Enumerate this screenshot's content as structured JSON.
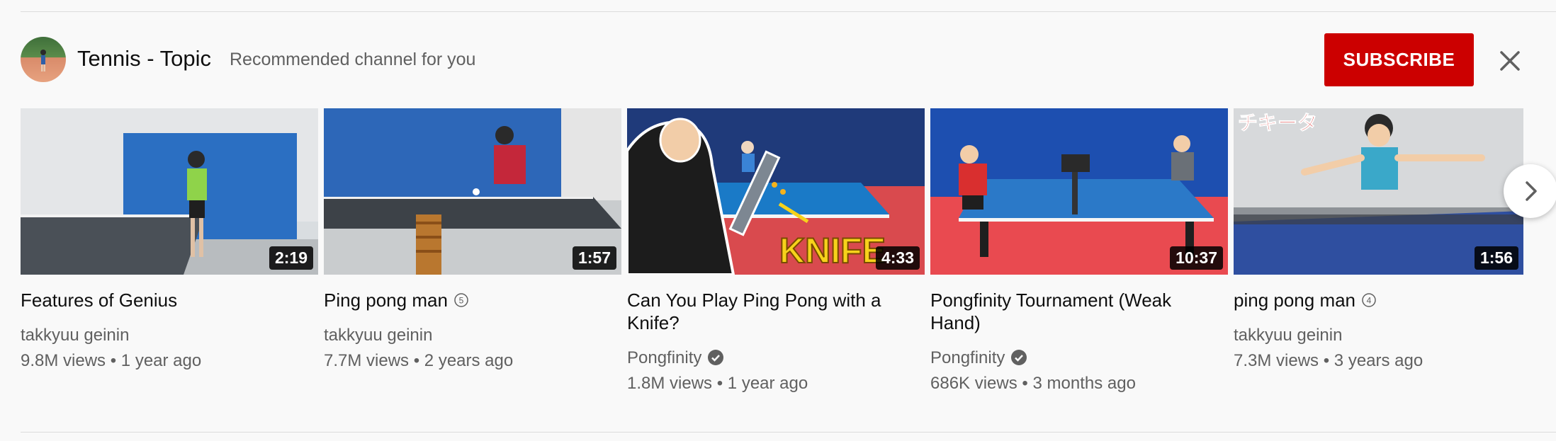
{
  "shelf": {
    "channel_name": "Tennis - Topic",
    "subtitle": "Recommended channel for you",
    "subscribe_label": "SUBSCRIBE",
    "accent": "#cc0000"
  },
  "videos": [
    {
      "title": "Features of Genius",
      "badge": "",
      "channel": "takkyuu geinin",
      "verified": false,
      "views": "9.8M views",
      "age": "1 year ago",
      "duration": "2:19"
    },
    {
      "title": "Ping pong man",
      "badge": "5",
      "channel": "takkyuu geinin",
      "verified": false,
      "views": "7.7M views",
      "age": "2 years ago",
      "duration": "1:57"
    },
    {
      "title": "Can You Play Ping Pong with a Knife?",
      "badge": "",
      "channel": "Pongfinity",
      "verified": true,
      "views": "1.8M views",
      "age": "1 year ago",
      "duration": "4:33",
      "overlay_text": "KNIFE"
    },
    {
      "title": "Pongfinity Tournament (Weak Hand)",
      "badge": "",
      "channel": "Pongfinity",
      "verified": true,
      "views": "686K views",
      "age": "3 months ago",
      "duration": "10:37"
    },
    {
      "title": "ping pong man",
      "badge": "4",
      "channel": "takkyuu geinin",
      "verified": false,
      "views": "7.3M views",
      "age": "3 years ago",
      "duration": "1:56",
      "overlay_text": "チキータ"
    }
  ],
  "separator": "•",
  "icons": {
    "close": "close-icon",
    "next": "chevron-right-icon",
    "verified": "verified-check-icon"
  }
}
